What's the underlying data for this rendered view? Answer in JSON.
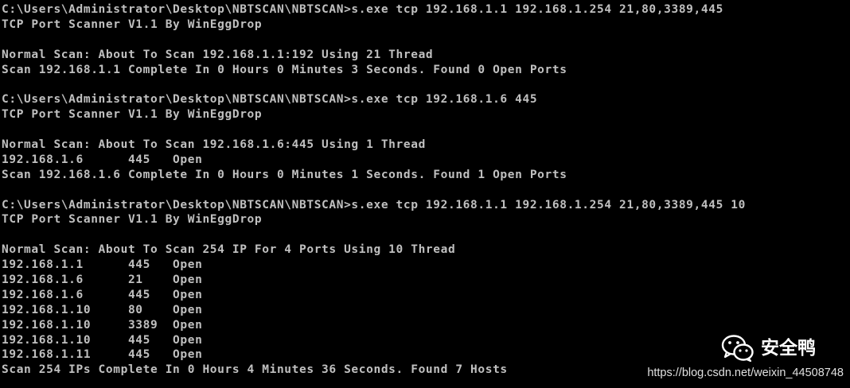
{
  "console": {
    "lines": [
      "C:\\Users\\Administrator\\Desktop\\NBTSCAN\\NBTSCAN>s.exe tcp 192.168.1.1 192.168.1.254 21,80,3389,445",
      "TCP Port Scanner V1.1 By WinEggDrop",
      "",
      "Normal Scan: About To Scan 192.168.1.1:192 Using 21 Thread",
      "Scan 192.168.1.1 Complete In 0 Hours 0 Minutes 3 Seconds. Found 0 Open Ports",
      "",
      "C:\\Users\\Administrator\\Desktop\\NBTSCAN\\NBTSCAN>s.exe tcp 192.168.1.6 445",
      "TCP Port Scanner V1.1 By WinEggDrop",
      "",
      "Normal Scan: About To Scan 192.168.1.6:445 Using 1 Thread",
      "192.168.1.6      445   Open",
      "Scan 192.168.1.6 Complete In 0 Hours 0 Minutes 1 Seconds. Found 1 Open Ports",
      "",
      "C:\\Users\\Administrator\\Desktop\\NBTSCAN\\NBTSCAN>s.exe tcp 192.168.1.1 192.168.1.254 21,80,3389,445 10",
      "TCP Port Scanner V1.1 By WinEggDrop",
      "",
      "Normal Scan: About To Scan 254 IP For 4 Ports Using 10 Thread",
      "192.168.1.1      445   Open",
      "192.168.1.6      21    Open",
      "192.168.1.6      445   Open",
      "192.168.1.10     80    Open",
      "192.168.1.10     3389  Open",
      "192.168.1.10     445   Open",
      "192.168.1.11     445   Open",
      "Scan 254 IPs Complete In 0 Hours 4 Minutes 36 Seconds. Found 7 Hosts"
    ]
  },
  "watermark": {
    "brand": "安全鸭",
    "url": "https://blog.csdn.net/weixin_44508748",
    "icon": "wechat-icon"
  },
  "colors": {
    "background": "#000000",
    "text": "#c0c0c0"
  }
}
